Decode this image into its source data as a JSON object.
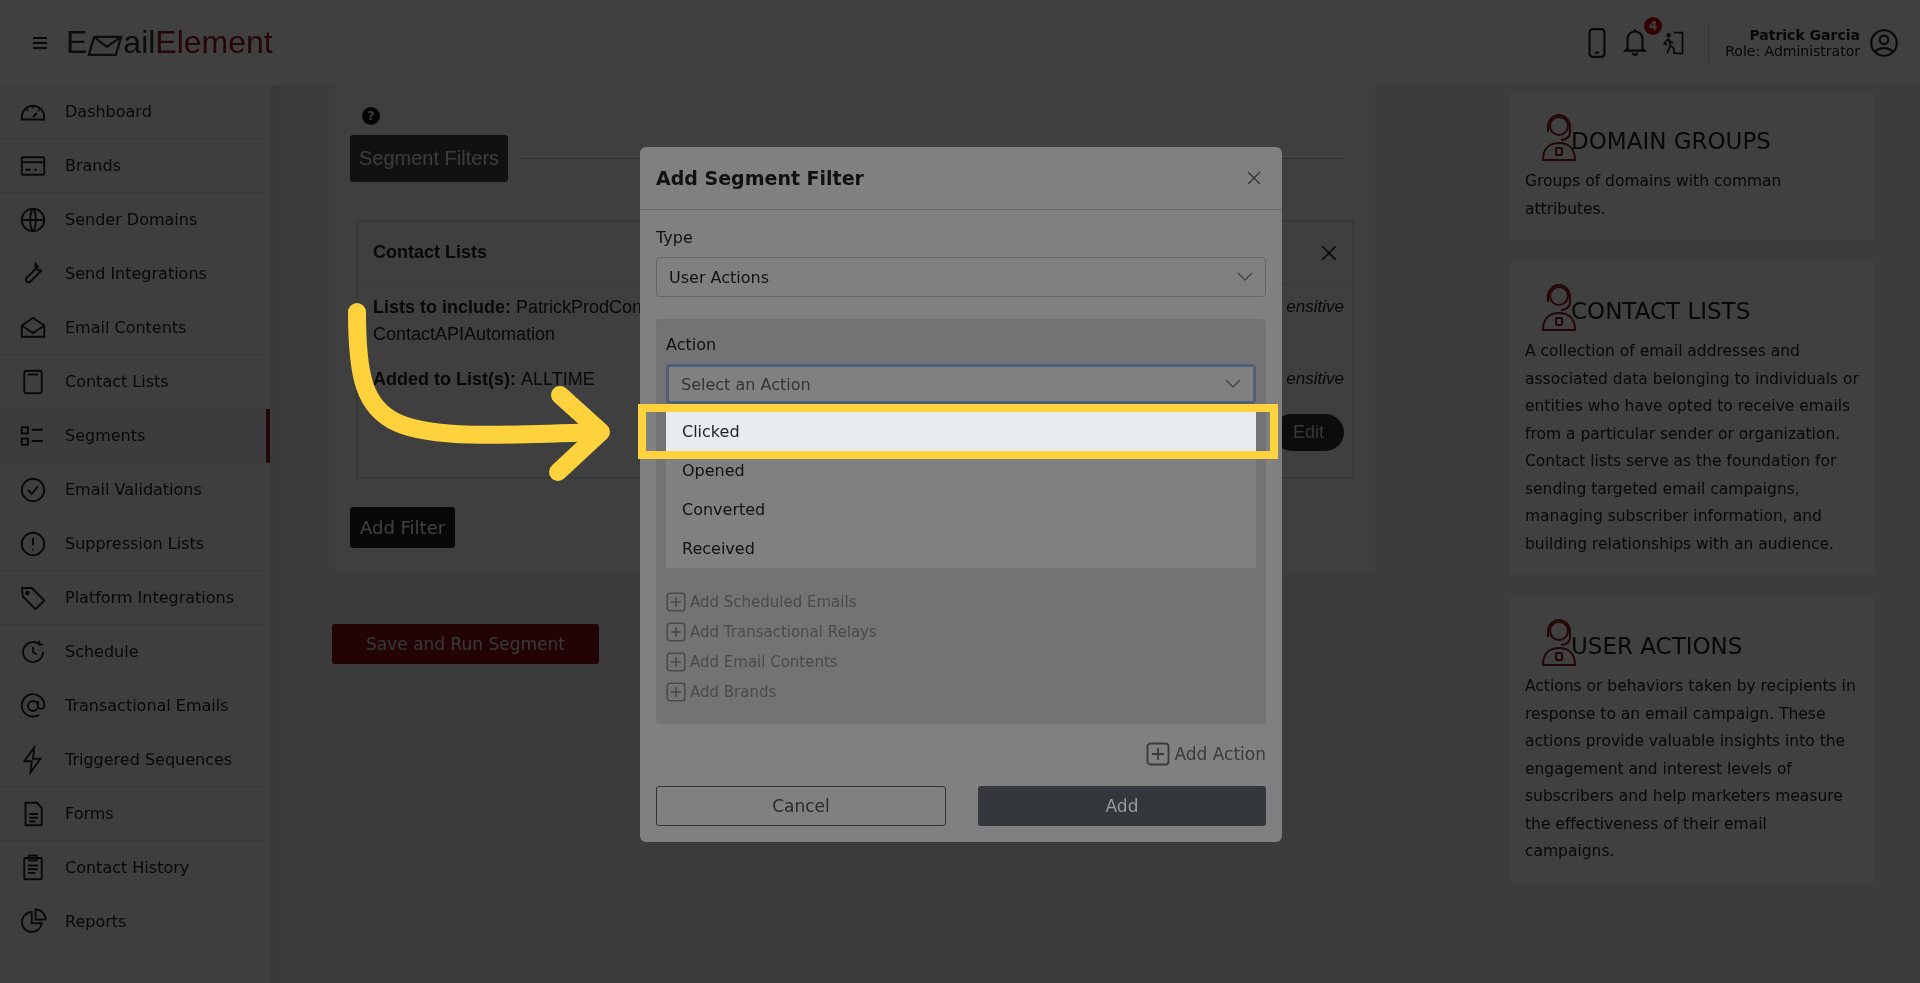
{
  "header": {
    "logo": {
      "start": "E",
      "middle": "ail",
      "accent": "Element"
    },
    "notification_count": "4",
    "user": {
      "name": "Patrick Garcia",
      "role": "Role: Administrator"
    }
  },
  "sidebar": {
    "items": [
      {
        "label": "Dashboard",
        "selected": false
      },
      {
        "label": "Brands",
        "selected": false
      },
      {
        "label": "Sender Domains",
        "selected": false
      },
      {
        "label": "Send Integrations",
        "selected": false
      },
      {
        "label": "Email Contents",
        "selected": false
      },
      {
        "label": "Contact Lists",
        "selected": false
      },
      {
        "label": "Segments",
        "selected": true
      },
      {
        "label": "Email Validations",
        "selected": false
      },
      {
        "label": "Suppression Lists",
        "selected": false
      },
      {
        "label": "Platform Integrations",
        "selected": false
      },
      {
        "label": "Schedule",
        "selected": false
      },
      {
        "label": "Transactional Emails",
        "selected": false
      },
      {
        "label": "Triggered Sequences",
        "selected": false
      },
      {
        "label": "Forms",
        "selected": false
      },
      {
        "label": "Contact History",
        "selected": false
      },
      {
        "label": "Reports",
        "selected": false
      }
    ]
  },
  "segment_page": {
    "help": "?",
    "tab": "Segment Filters",
    "filter_card": {
      "title": "Contact Lists",
      "rows": [
        {
          "label": "Lists to include:",
          "value": "PatrickProdCon",
          "value_2": "ContactAPIAutomation",
          "trailing": "ensitive"
        },
        {
          "label": "Added to List(s):",
          "value": "ALLTIME",
          "trailing": "ensitive"
        }
      ],
      "edit_button": "Edit"
    },
    "add_filter": "Add Filter",
    "save_button": "Save and Run Segment"
  },
  "info_cards": [
    {
      "title": "DOMAIN GROUPS",
      "text": "Groups of domains with comman attributes."
    },
    {
      "title": "CONTACT LISTS",
      "text": "A collection of email addresses and associated data belonging to individuals or entities who have opted to receive emails from a particular sender or organization. Contact lists serve as the foundation for sending targeted email campaigns, managing subscriber information, and building relationships with an audience."
    },
    {
      "title": "USER ACTIONS",
      "text": "Actions or behaviors taken by recipients in response to an email campaign. These actions provide valuable insights into the engagement and interest levels of subscribers and help marketers measure the effectiveness of their email campaigns."
    }
  ],
  "dialog": {
    "title": "Add Segment Filter",
    "type_label": "Type",
    "type_value": "User Actions",
    "action_label": "Action",
    "action_placeholder": "Select an Action",
    "action_options": [
      {
        "label": "Clicked",
        "selected": true
      },
      {
        "label": "Opened",
        "selected": false
      },
      {
        "label": "Converted",
        "selected": false
      },
      {
        "label": "Received",
        "selected": false
      }
    ],
    "add_links": [
      {
        "label": "Add Scheduled Emails",
        "disabled": true
      },
      {
        "label": "Add Transactional Relays",
        "disabled": true
      },
      {
        "label": "Add Email Contents",
        "disabled": true
      },
      {
        "label": "Add Brands",
        "disabled": true
      }
    ],
    "add_action": "Add Action",
    "cancel": "Cancel",
    "submit": "Add"
  }
}
